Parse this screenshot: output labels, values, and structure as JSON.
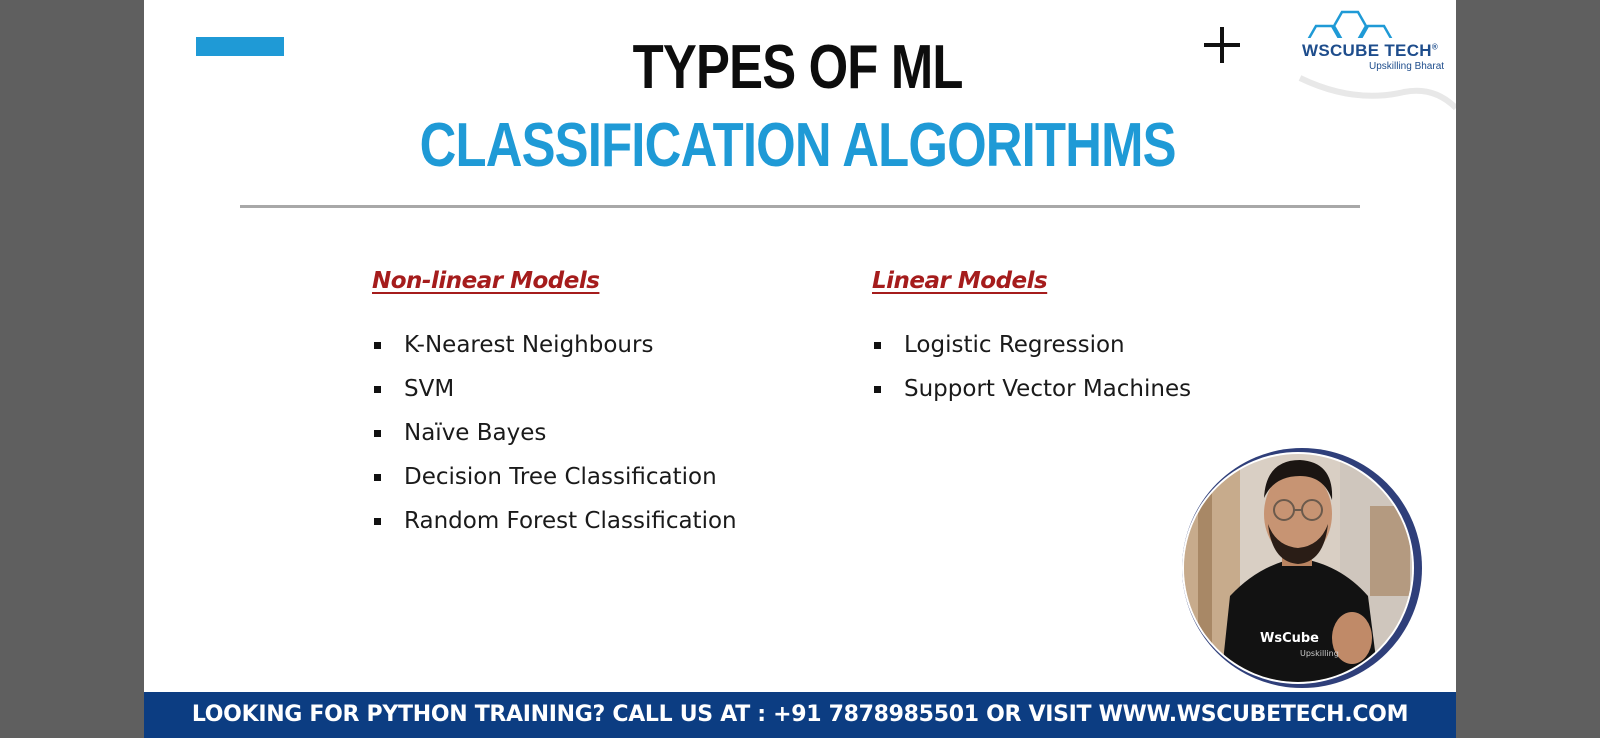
{
  "slide": {
    "title_main": "TYPES OF ML",
    "title_sub": "CLASSIFICATION ALGORITHMS",
    "accent_color": "#1f9ad6",
    "heading_color": "#a51c1c"
  },
  "logo": {
    "name": "WsCube Tech",
    "display_text": "WSCUBE TECH",
    "registered_mark": "®",
    "tagline": "Upskilling Bharat",
    "icon": "hexagon-molecule-icon"
  },
  "columns": {
    "nonlinear": {
      "heading": "Non-linear Models",
      "items": [
        "K-Nearest Neighbours",
        "SVM",
        "Naïve Bayes",
        "Decision Tree Classification",
        "Random Forest Classification"
      ]
    },
    "linear": {
      "heading": "Linear Models",
      "items": [
        "Logistic Regression",
        "Support Vector Machines"
      ]
    }
  },
  "presenter": {
    "shirt_text": "WsCube",
    "shirt_tagline": "Upskilling"
  },
  "footer": {
    "text": "LOOKING FOR PYTHON TRAINING? CALL US AT : +91 7878985501 OR VISIT WWW.WSCUBETECH.COM",
    "background_color": "#0c3d82"
  }
}
